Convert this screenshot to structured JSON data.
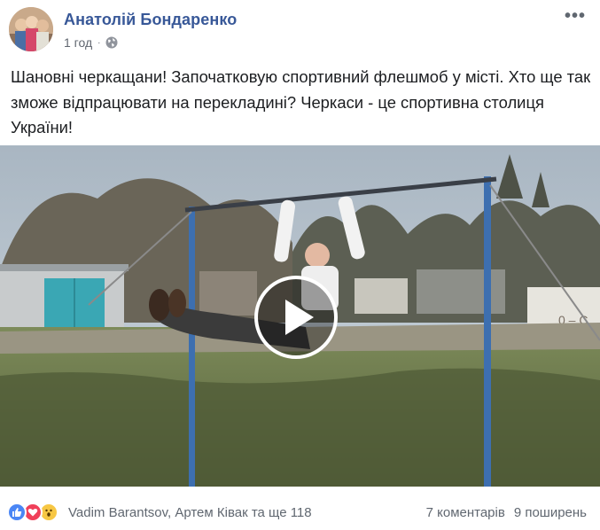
{
  "post": {
    "author": "Анатолій Бондаренко",
    "time": "1 год",
    "separator": "·",
    "text": "Шановні черкащани! Започатковую спортивний флешмоб у місті. Хто ще так зможе відпрацювати на перекладині? Черкаси - це спортивна столиця України!",
    "more_label": "•••"
  },
  "video": {
    "sign_text": "0 – С"
  },
  "footer": {
    "reaction_names": "Vadim Barantsov, Артем Ківак та ще 118",
    "comments": "7 коментарів",
    "shares": "9 поширень"
  },
  "icons": {
    "privacy": "globe-icon",
    "play": "play-icon",
    "reactions": [
      "like-icon",
      "love-icon",
      "wow-icon"
    ]
  },
  "colors": {
    "author": "#385898",
    "meta": "#616770",
    "like": "#4a86f5",
    "love": "#f0405a",
    "wow": "#f7c744"
  }
}
